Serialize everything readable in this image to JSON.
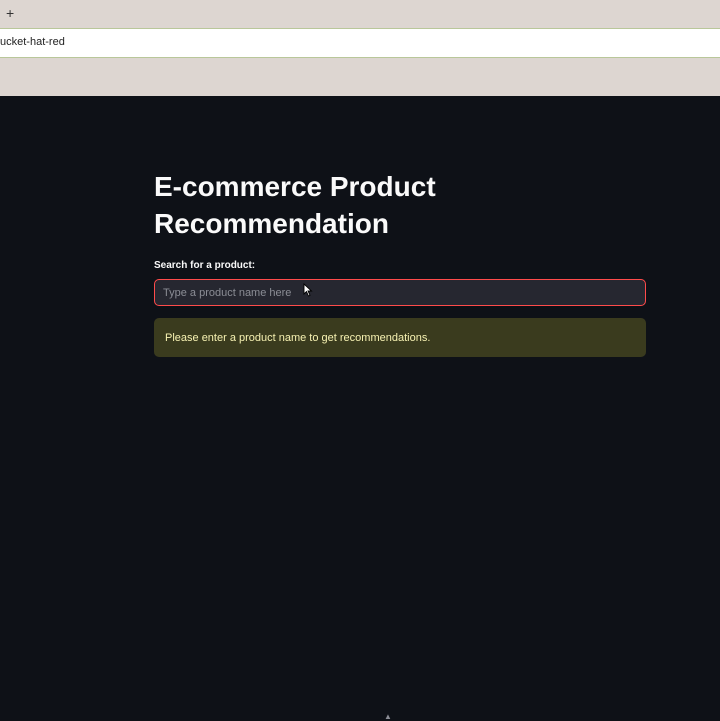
{
  "browser": {
    "new_tab_glyph": "+",
    "address_text": "ucket-hat-red"
  },
  "app": {
    "title": "E-commerce Product Recommendation",
    "search": {
      "label": "Search for a product:",
      "placeholder": "Type a product name here",
      "value": ""
    },
    "alert": {
      "message": "Please enter a product name to get recommendations."
    }
  },
  "colors": {
    "background": "#0e1117",
    "input_background": "#262730",
    "input_focus_border": "#ff4b4b",
    "alert_background": "#3a3b1e",
    "alert_text": "#f7f2b2"
  },
  "icons": {
    "new_tab": "plus-icon",
    "cursor": "mouse-pointer-icon",
    "collapse": "chevron-up-icon"
  }
}
